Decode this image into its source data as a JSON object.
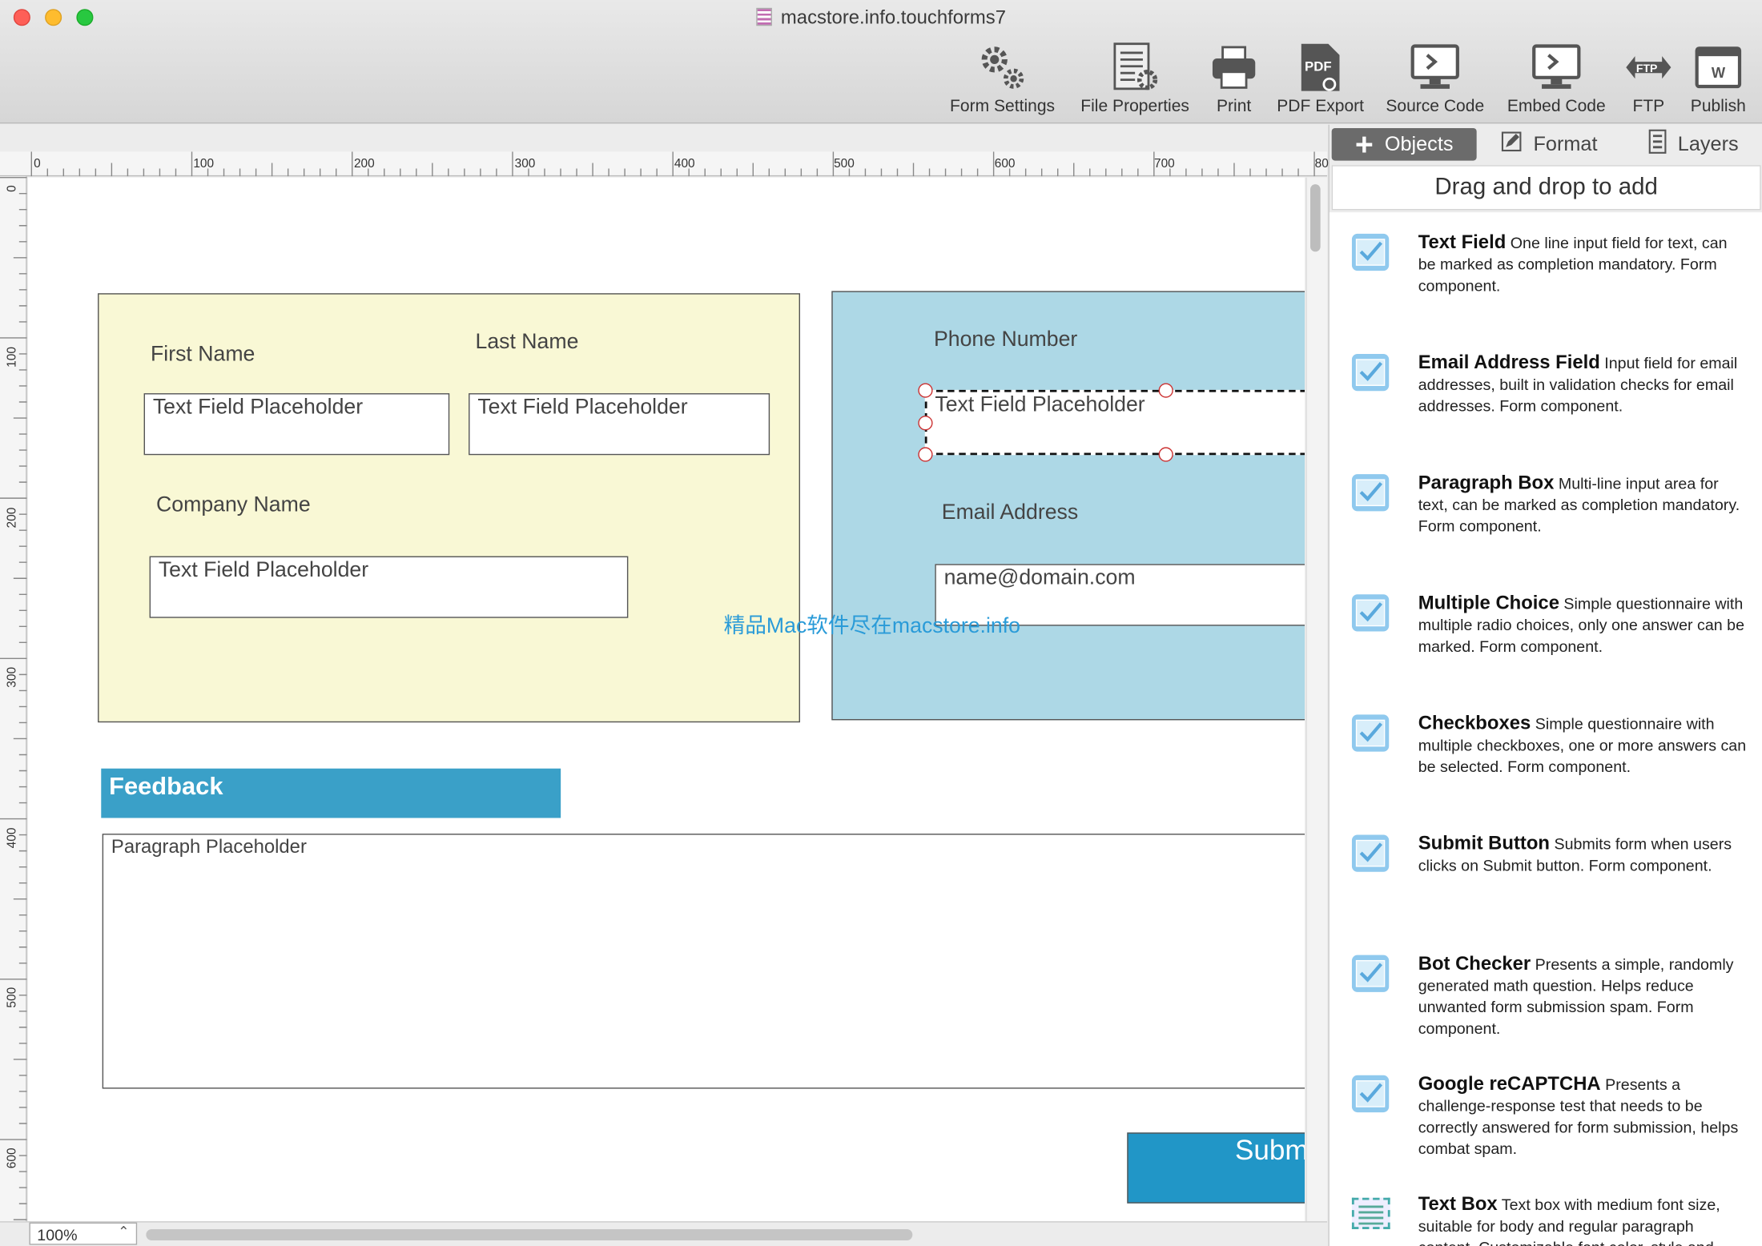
{
  "window": {
    "title": "macstore.info.touchforms7"
  },
  "toolbar": {
    "form_settings": "Form Settings",
    "file_properties": "File Properties",
    "print": "Print",
    "pdf_export": "PDF Export",
    "source_code": "Source Code",
    "embed_code": "Embed Code",
    "ftp": "FTP",
    "publish": "Publish"
  },
  "ruler": {
    "h": [
      "0",
      "100",
      "200",
      "300",
      "400",
      "500",
      "600",
      "700",
      "80"
    ],
    "v": [
      "0",
      "100",
      "200",
      "300",
      "400",
      "500",
      "600"
    ]
  },
  "form": {
    "first_name_label": "First Name",
    "last_name_label": "Last Name",
    "company_name_label": "Company Name",
    "phone_label": "Phone Number",
    "email_label": "Email Address",
    "placeholder": "Text Field Placeholder",
    "email_placeholder": "name@domain.com",
    "feedback_header": "Feedback",
    "paragraph_placeholder": "Paragraph Placeholder",
    "submit_label": "Subm",
    "watermark": "精品Mac软件尽在macstore.info"
  },
  "zoom": "100%",
  "panel": {
    "tabs": {
      "objects": "Objects",
      "format": "Format",
      "layers": "Layers"
    },
    "drag_title": "Drag and drop to add",
    "components": [
      {
        "name": "Text Field",
        "desc": "One line input field for text, can be marked as completion mandatory.  Form component."
      },
      {
        "name": "Email Address Field",
        "desc": "Input field for email addresses, built in validation checks for email addresses.  Form component."
      },
      {
        "name": "Paragraph Box",
        "desc": "Multi-line input area for text, can be marked as completion mandatory.  Form component."
      },
      {
        "name": "Multiple Choice",
        "desc": "Simple questionnaire with multiple radio choices, only one answer can be marked.  Form component."
      },
      {
        "name": "Checkboxes",
        "desc": "Simple questionnaire with multiple checkboxes, one or more answers can be selected.  Form component."
      },
      {
        "name": "Submit Button",
        "desc": "Submits form when users clicks on Submit button.  Form component."
      },
      {
        "name": "Bot Checker",
        "desc": "Presents a simple, randomly generated math question.  Helps reduce unwanted form submission spam.  Form component."
      },
      {
        "name": "Google reCAPTCHA",
        "desc": "Presents a challenge-response test that needs to be correctly answered for form submission, helps combat spam."
      },
      {
        "name": "Text Box",
        "desc": "Text box with medium font size, suitable for body and regular paragraph content. Customizable font color, style and"
      }
    ]
  }
}
